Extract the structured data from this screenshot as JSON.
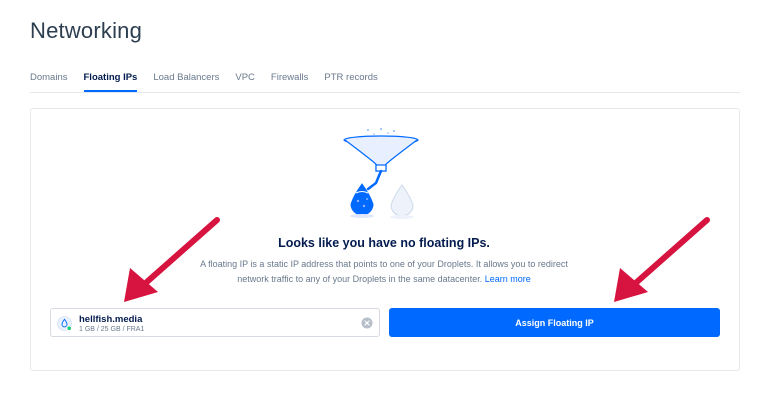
{
  "page": {
    "title": "Networking"
  },
  "tabs": [
    {
      "label": "Domains",
      "active": false
    },
    {
      "label": "Floating IPs",
      "active": true
    },
    {
      "label": "Load Balancers",
      "active": false
    },
    {
      "label": "VPC",
      "active": false
    },
    {
      "label": "Firewalls",
      "active": false
    },
    {
      "label": "PTR records",
      "active": false
    }
  ],
  "empty_state": {
    "title": "Looks like you have no floating IPs.",
    "description": "A floating IP is a static IP address that points to one of your Droplets. It allows you to redirect network traffic to any of your Droplets in the same datacenter.",
    "learn_more": "Learn more"
  },
  "droplet": {
    "name": "hellfish.media",
    "meta": "1 GB / 25 GB / FRA1",
    "status_color": "#15cd72"
  },
  "assign_button": {
    "label": "Assign Floating IP"
  },
  "colors": {
    "accent": "#0069ff",
    "arrow": "#d7143f"
  },
  "icons": [
    "funnel-illustration",
    "droplet-icon",
    "clear-icon",
    "arrow-icon"
  ]
}
